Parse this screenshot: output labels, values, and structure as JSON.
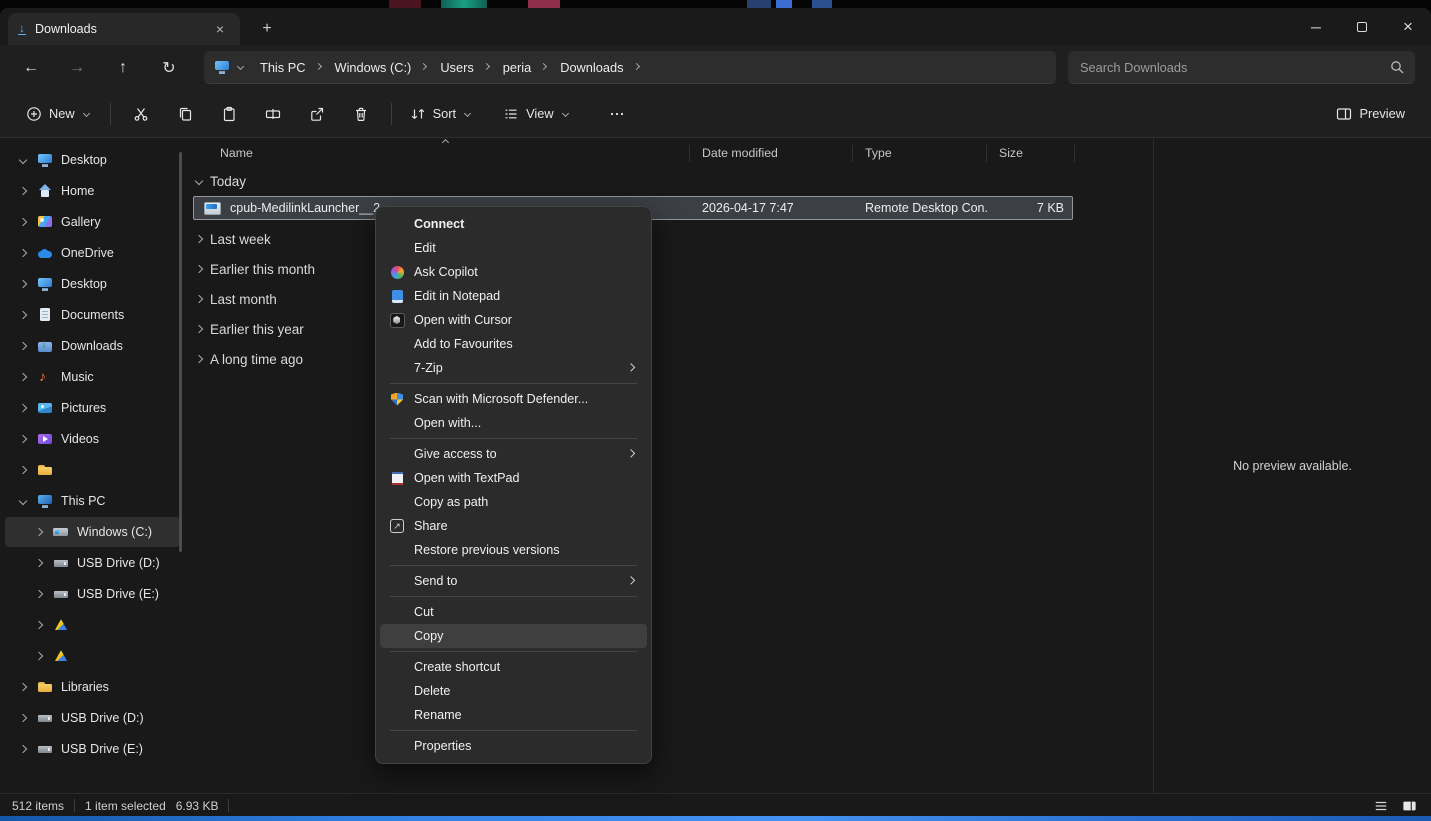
{
  "window": {
    "tab_title": "Downloads"
  },
  "icons": {
    "back": "←",
    "forward": "→",
    "up": "↑",
    "refresh": "↻",
    "close": "×",
    "minimize": "─",
    "new_tab": "+",
    "download_arrow": "↓"
  },
  "breadcrumb": {
    "segments": [
      "This PC",
      "Windows (C:)",
      "Users",
      "peria",
      "Downloads"
    ]
  },
  "search": {
    "placeholder": "Search Downloads"
  },
  "toolbar": {
    "new_label": "New",
    "sort_label": "Sort",
    "view_label": "View",
    "preview_label": "Preview"
  },
  "sidebar": {
    "items": [
      {
        "label": "Desktop",
        "icon": "monitor",
        "chevron": "down",
        "indent": 0
      },
      {
        "label": "Home",
        "icon": "home",
        "chevron": "right",
        "indent": 0
      },
      {
        "label": "Gallery",
        "icon": "gallery",
        "chevron": "right",
        "indent": 0
      },
      {
        "label": "OneDrive",
        "icon": "cloud",
        "chevron": "right",
        "indent": 0
      },
      {
        "label": "Desktop",
        "icon": "desktopf",
        "chevron": "right",
        "indent": 0
      },
      {
        "label": "Documents",
        "icon": "documents",
        "chevron": "right",
        "indent": 0
      },
      {
        "label": "Downloads",
        "icon": "download",
        "chevron": "right",
        "indent": 0
      },
      {
        "label": "Music",
        "icon": "music",
        "chevron": "right",
        "indent": 0
      },
      {
        "label": "Pictures",
        "icon": "pictures",
        "chevron": "right",
        "indent": 0
      },
      {
        "label": "Videos",
        "icon": "videos",
        "chevron": "right",
        "indent": 0
      },
      {
        "label": "",
        "icon": "folder",
        "chevron": "right",
        "indent": 0
      },
      {
        "label": "This PC",
        "icon": "pc",
        "chevron": "down",
        "indent": 0
      },
      {
        "label": "Windows (C:)",
        "icon": "windrive",
        "chevron": "right",
        "indent": 1,
        "selected": true
      },
      {
        "label": "USB Drive (D:)",
        "icon": "usb",
        "chevron": "right",
        "indent": 1
      },
      {
        "label": "USB Drive (E:)",
        "icon": "usb",
        "chevron": "right",
        "indent": 1
      },
      {
        "label": "",
        "icon": "gdrive",
        "chevron": "right",
        "indent": 1
      },
      {
        "label": "",
        "icon": "gdrive",
        "chevron": "right",
        "indent": 1
      },
      {
        "label": "Libraries",
        "icon": "folder",
        "chevron": "right",
        "indent": 0
      },
      {
        "label": "USB Drive (D:)",
        "icon": "usb",
        "chevron": "right",
        "indent": 0
      },
      {
        "label": "USB Drive (E:)",
        "icon": "usb",
        "chevron": "right",
        "indent": 0
      }
    ]
  },
  "columns": {
    "name": "Name",
    "date": "Date modified",
    "type": "Type",
    "size": "Size"
  },
  "list": {
    "today_group": "Today",
    "file": {
      "name": "cpub-MedilinkLauncher__2_",
      "date_modified": "2026-04-17 7:47",
      "type": "Remote Desktop Con...",
      "size": "7 KB"
    },
    "collapsed_groups": [
      "Last week",
      "Earlier this month",
      "Last month",
      "Earlier this year",
      "A long time ago"
    ]
  },
  "context_menu": {
    "items": [
      {
        "label": "Connect",
        "bold": true
      },
      {
        "label": "Edit"
      },
      {
        "label": "Ask Copilot",
        "icon": "copilot"
      },
      {
        "label": "Edit in Notepad",
        "icon": "notepad"
      },
      {
        "label": "Open with Cursor",
        "icon": "cursorapp"
      },
      {
        "label": "Add to Favourites"
      },
      {
        "label": "7-Zip",
        "submenu": true
      },
      {
        "separator": true
      },
      {
        "label": "Scan with Microsoft Defender...",
        "icon": "defender"
      },
      {
        "label": "Open with..."
      },
      {
        "separator": true
      },
      {
        "label": "Give access to",
        "submenu": true
      },
      {
        "label": "Open with TextPad",
        "icon": "textpad"
      },
      {
        "label": "Copy as path"
      },
      {
        "label": "Share",
        "icon": "share"
      },
      {
        "label": "Restore previous versions"
      },
      {
        "separator": true
      },
      {
        "label": "Send to",
        "submenu": true
      },
      {
        "separator": true
      },
      {
        "label": "Cut"
      },
      {
        "label": "Copy",
        "hover": true
      },
      {
        "separator": true
      },
      {
        "label": "Create shortcut"
      },
      {
        "label": "Delete"
      },
      {
        "label": "Rename"
      },
      {
        "separator": true
      },
      {
        "label": "Properties"
      }
    ]
  },
  "preview_pane": {
    "message": "No preview available."
  },
  "status_bar": {
    "total": "512 items",
    "selection": "1 item selected",
    "selection_size": "6.93 KB"
  }
}
